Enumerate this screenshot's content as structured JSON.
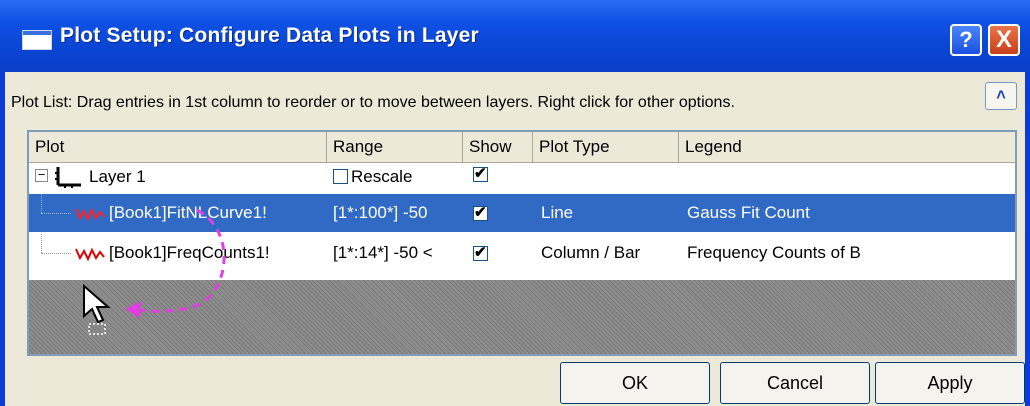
{
  "window": {
    "title": "Plot Setup: Configure Data Plots in Layer",
    "help_label": "?",
    "close_label": "X"
  },
  "plot_list": {
    "label": "Plot List: Drag entries in 1st column to reorder or to move between layers. Right click for other options.",
    "collapse_label": "˄"
  },
  "table": {
    "columns": [
      "Plot",
      "Range",
      "Show",
      "Plot Type",
      "Legend"
    ],
    "layer": {
      "name": "Layer 1",
      "rescale_label": "Rescale",
      "rescale_checked": false,
      "show_checked": true,
      "expander": "−"
    },
    "rows": [
      {
        "plot": "[Book1]FitNLCurve1!",
        "range": "[1*:100*]  -50",
        "show": true,
        "plot_type": "Line",
        "legend": "Gauss Fit Count",
        "selected": true
      },
      {
        "plot": "[Book1]FreqCounts1!",
        "range": "[1*:14*]  -50 <",
        "show": true,
        "plot_type": "Column / Bar",
        "legend": "Frequency Counts of B",
        "selected": false
      }
    ]
  },
  "buttons": {
    "ok": "OK",
    "cancel": "Cancel",
    "apply": "Apply"
  },
  "colors": {
    "selection": "#316ac5",
    "drag_arrow": "#e040e0",
    "plot_icon": "#e00000"
  },
  "icons": {
    "layer": "layer-axis-icon",
    "plot": "line-plot-icon",
    "cursor": "mouse-pointer-icon",
    "drag": "drag-arrow-icon"
  }
}
